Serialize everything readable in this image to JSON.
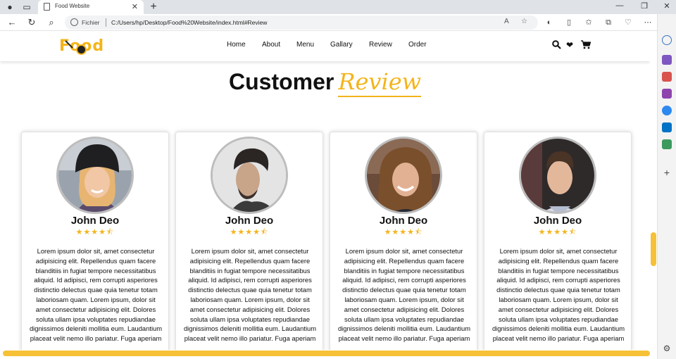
{
  "browser": {
    "tab_title": "Food Website",
    "addr_prefix": "Fichier",
    "url": "C:/Users/hp/Desktop/Food%20Website/index.html#Review"
  },
  "site": {
    "logo_text": "Food",
    "nav": [
      "Home",
      "About",
      "Menu",
      "Gallary",
      "Review",
      "Order"
    ],
    "accent_color": "#f4b41a"
  },
  "section": {
    "title_main": "Customer",
    "title_accent": "Review"
  },
  "reviews": [
    {
      "name": "John Deo",
      "rating": 4.5,
      "stars": "★★★★⯪"
    },
    {
      "name": "John Deo",
      "rating": 4.5,
      "stars": "★★★★⯪"
    },
    {
      "name": "John Deo",
      "rating": 4.5,
      "stars": "★★★★⯪"
    },
    {
      "name": "John Deo",
      "rating": 4.5,
      "stars": "★★★★⯪"
    }
  ],
  "review_text": "Lorem ipsum dolor sit, amet consectetur adipisicing elit. Repellendus quam facere blanditiis in fugiat tempore necessitatibus aliquid. Id adipisci, rem corrupti asperiores distinctio delectus quae quia tenetur totam laboriosam quam. Lorem ipsum, dolor sit amet consectetur adipisicing elit. Dolores soluta ullam ipsa voluptates repudiandae dignissimos deleniti mollitia eum. Laudantium placeat velit nemo illo pariatur. Fuga aperiam"
}
